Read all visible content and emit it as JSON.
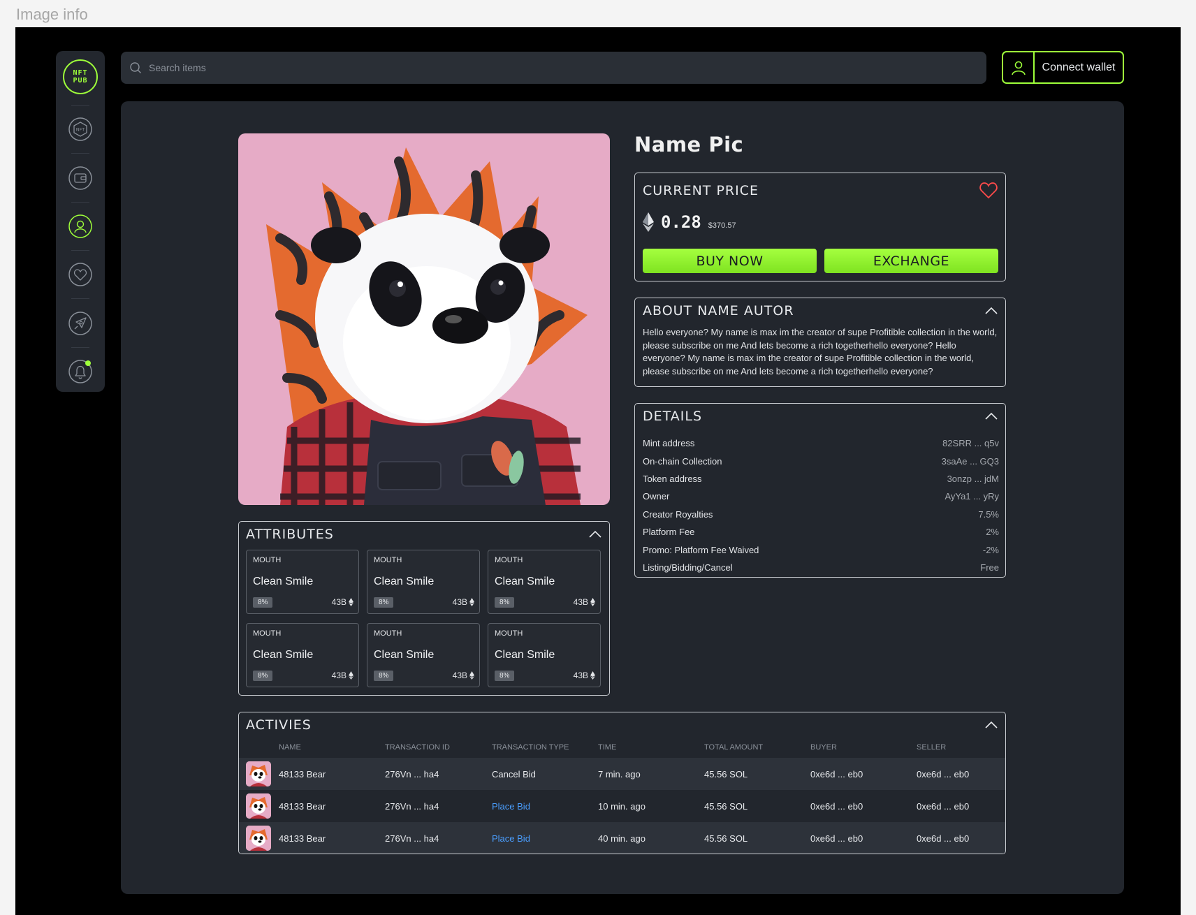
{
  "page_header": "Image info",
  "brand": {
    "line1": "NFT",
    "line2": "PUB",
    "accent": "#9eff3a"
  },
  "sidebar": {
    "items": [
      {
        "icon": "nft-hexagon-icon"
      },
      {
        "icon": "wallet-icon"
      },
      {
        "icon": "user-icon"
      },
      {
        "icon": "heart-icon"
      },
      {
        "icon": "rocket-icon"
      },
      {
        "icon": "bell-icon"
      }
    ]
  },
  "search": {
    "placeholder": "Search items"
  },
  "wallet": {
    "label": "Connect wallet"
  },
  "nft": {
    "title": "Name Pic"
  },
  "price": {
    "header": "CURRENT PRICE",
    "value": "0.28",
    "usd": "$370.57",
    "buy_label": "BUY NOW",
    "exchange_label": "EXCHANGE"
  },
  "about": {
    "header": "ABOUT NAME AUTOR",
    "text": "Hello everyone? My name is max im the creator  of supe  Profitible collection in the world, please subscribe on me  And lets become a rich togetherhello everyone? Hello everyone? My name is max im the creator  of supe  Profitible collection in the world, please subscribe on me  And lets become a rich togetherhello everyone?"
  },
  "details": {
    "header": "DETAILS",
    "rows": [
      {
        "label": "Mint address",
        "value": "82SRR ... q5v"
      },
      {
        "label": "On-chain Collection",
        "value": "3saAe ... GQ3"
      },
      {
        "label": "Token address",
        "value": "3onzp ... jdM"
      },
      {
        "label": "Owner",
        "value": "AyYa1 ... yRy"
      },
      {
        "label": "Creator Royalties",
        "value": "7.5%"
      },
      {
        "label": "Platform Fee",
        "value": "2%"
      },
      {
        "label": "Promo: Platform Fee Waived",
        "value": "-2%"
      },
      {
        "label": "Listing/Bidding/Cancel",
        "value": "Free"
      }
    ]
  },
  "attributes": {
    "header": "ATTRIBUTES",
    "items": [
      {
        "type": "MOUTH",
        "name": "Clean Smile",
        "pct": "8%",
        "count": "43B"
      },
      {
        "type": "MOUTH",
        "name": "Clean Smile",
        "pct": "8%",
        "count": "43B"
      },
      {
        "type": "MOUTH",
        "name": "Clean Smile",
        "pct": "8%",
        "count": "43B"
      },
      {
        "type": "MOUTH",
        "name": "Clean Smile",
        "pct": "8%",
        "count": "43B"
      },
      {
        "type": "MOUTH",
        "name": "Clean Smile",
        "pct": "8%",
        "count": "43B"
      },
      {
        "type": "MOUTH",
        "name": "Clean Smile",
        "pct": "8%",
        "count": "43B"
      }
    ]
  },
  "activities": {
    "header": "ACTIVIES",
    "columns": [
      "NAME",
      "TRANSACTION ID",
      "TRANSACTION TYPE",
      "TIME",
      "TOTAL AMOUNT",
      "BUYER",
      "SELLER"
    ],
    "rows": [
      {
        "name": "48133 Bear",
        "tx": "276Vn ... ha4",
        "type": "Cancel Bid",
        "time": "7 min. ago",
        "amount": "45.56 SOL",
        "buyer": "0xe6d ... eb0",
        "seller": "0xe6d ... eb0"
      },
      {
        "name": "48133 Bear",
        "tx": "276Vn ... ha4",
        "type": "Place Bid",
        "time": "10 min. ago",
        "amount": "45.56 SOL",
        "buyer": "0xe6d ... eb0",
        "seller": "0xe6d ... eb0"
      },
      {
        "name": "48133 Bear",
        "tx": "276Vn ... ha4",
        "type": "Place Bid",
        "time": "40 min. ago",
        "amount": "45.56 SOL",
        "buyer": "0xe6d ... eb0",
        "seller": "0xe6d ... eb0"
      }
    ]
  }
}
